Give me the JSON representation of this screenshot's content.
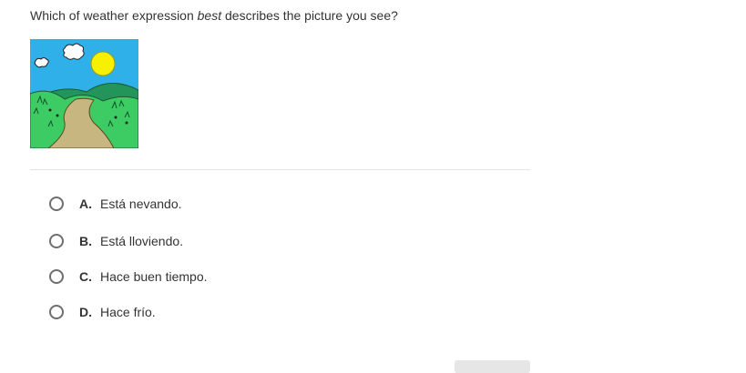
{
  "question": {
    "prefix": "Which of weather expression ",
    "emphasis": "best",
    "suffix": " describes the picture you see?"
  },
  "image": {
    "icon": "landscape-picture",
    "colors": {
      "sky": "#2fb0e8",
      "sun": "#f7f000",
      "hills": "#2dbf55",
      "path": "#c8b680"
    }
  },
  "choices": [
    {
      "letter": "A.",
      "text": "Está nevando."
    },
    {
      "letter": "B.",
      "text": "Está lloviendo."
    },
    {
      "letter": "C.",
      "text": "Hace buen tiempo."
    },
    {
      "letter": "D.",
      "text": "Hace frío."
    }
  ]
}
